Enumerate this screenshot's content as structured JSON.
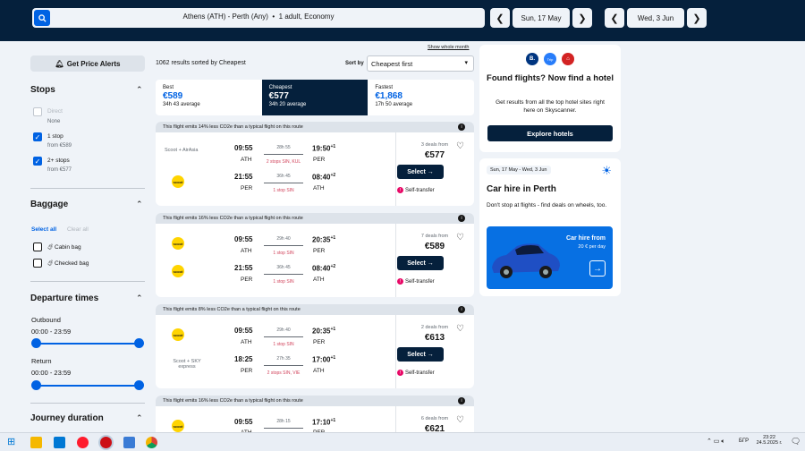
{
  "search": {
    "route": "Athens (ATH) - Perth (Any)",
    "pax": "1 adult, Economy"
  },
  "dates": {
    "depart": "Sun, 17 May",
    "return": "Wed, 3 Jun"
  },
  "sidebar": {
    "alert_label": "Get Price Alerts",
    "stops": {
      "title": "Stops",
      "items": [
        {
          "label": "Direct",
          "sub": "None",
          "checked": false
        },
        {
          "label": "1 stop",
          "sub": "from €589",
          "checked": true
        },
        {
          "label": "2+ stops",
          "sub": "from €577",
          "checked": true
        }
      ]
    },
    "baggage": {
      "title": "Baggage",
      "select_all": "Select all",
      "clear_all": "Clear all",
      "items": [
        {
          "label": "Cabin bag"
        },
        {
          "label": "Checked bag"
        }
      ]
    },
    "departure": {
      "title": "Departure times",
      "outbound_label": "Outbound",
      "outbound_range": "00:00 - 23:59",
      "return_label": "Return",
      "return_range": "00:00 - 23:59"
    },
    "journey": {
      "title": "Journey duration"
    }
  },
  "results": {
    "count_text": "1062 results sorted by Cheapest",
    "sort_label": "Sort by",
    "sort_value": "Cheapest first",
    "show_more": "Show whole month"
  },
  "tabs": [
    {
      "label": "Best",
      "price": "€589",
      "sub": "34h 43 average"
    },
    {
      "label": "Cheapest",
      "price": "€577",
      "sub": "34h 20 average"
    },
    {
      "label": "Fastest",
      "price": "€1,868",
      "sub": "17h 50 average"
    }
  ],
  "cards": [
    {
      "eco": "This flight emits 14% less CO2e than a typical flight on this route",
      "airline": "Scoot + AirAsia",
      "legs": [
        {
          "dep": "09:55",
          "from": "ATH",
          "dur": "28h 55",
          "arr": "19:50",
          "arr_sup": "+1",
          "to": "PER",
          "stops": "2 stops SIN, KUL"
        },
        {
          "dep": "21:55",
          "from": "PER",
          "dur": "36h 45",
          "arr": "08:40",
          "arr_sup": "+2",
          "to": "ATH",
          "stops": "1 stop SIN"
        }
      ],
      "deals": "3 deals from",
      "price": "€577",
      "select": "Select",
      "self": "Self-transfer"
    },
    {
      "eco": "This flight emits 16% less CO2e than a typical flight on this route",
      "airline": "",
      "legs": [
        {
          "dep": "09:55",
          "from": "ATH",
          "dur": "29h 40",
          "arr": "20:35",
          "arr_sup": "+1",
          "to": "PER",
          "stops": "1 stop SIN"
        },
        {
          "dep": "21:55",
          "from": "PER",
          "dur": "36h 45",
          "arr": "08:40",
          "arr_sup": "+2",
          "to": "ATH",
          "stops": "1 stop SIN"
        }
      ],
      "deals": "7 deals from",
      "price": "€589",
      "select": "Select",
      "self": "Self-transfer"
    },
    {
      "eco": "This flight emits 8% less CO2e than a typical flight on this route",
      "airline": "Scoot + SKY express",
      "legs": [
        {
          "dep": "09:55",
          "from": "ATH",
          "dur": "29h 40",
          "arr": "20:35",
          "arr_sup": "+1",
          "to": "PER",
          "stops": "1 stop SIN"
        },
        {
          "dep": "18:25",
          "from": "PER",
          "dur": "27h 35",
          "arr": "17:00",
          "arr_sup": "+1",
          "to": "ATH",
          "stops": "2 stops SIN, VIE"
        }
      ],
      "deals": "2 deals from",
      "price": "€613",
      "select": "Select",
      "self": "Self-transfer"
    },
    {
      "eco": "This flight emits 16% less CO2e than a typical flight on this route",
      "airline": "",
      "legs": [
        {
          "dep": "09:55",
          "from": "ATH",
          "dur": "28h 15",
          "arr": "17:10",
          "arr_sup": "+1",
          "to": "PER",
          "stops": ""
        }
      ],
      "deals": "6 deals from",
      "price": "€621"
    }
  ],
  "hotel_ad": {
    "title": "Found flights? Now find a hotel",
    "body": "Get results from all the top hotel sites right here on Skyscanner.",
    "button": "Explore hotels",
    "logo_b": "B.",
    "logo_trip": "Trip"
  },
  "car_ad": {
    "dates": "Sun, 17 May - Wed, 3 Jun",
    "title": "Car hire in Perth",
    "body": "Don't stop at flights - find deals on wheels, too.",
    "promo_title": "Car hire from",
    "promo_price": "20 € per day"
  },
  "taskbar": {
    "time": "23:22",
    "date": "24.5.2025 г.",
    "lang": "БГР"
  }
}
